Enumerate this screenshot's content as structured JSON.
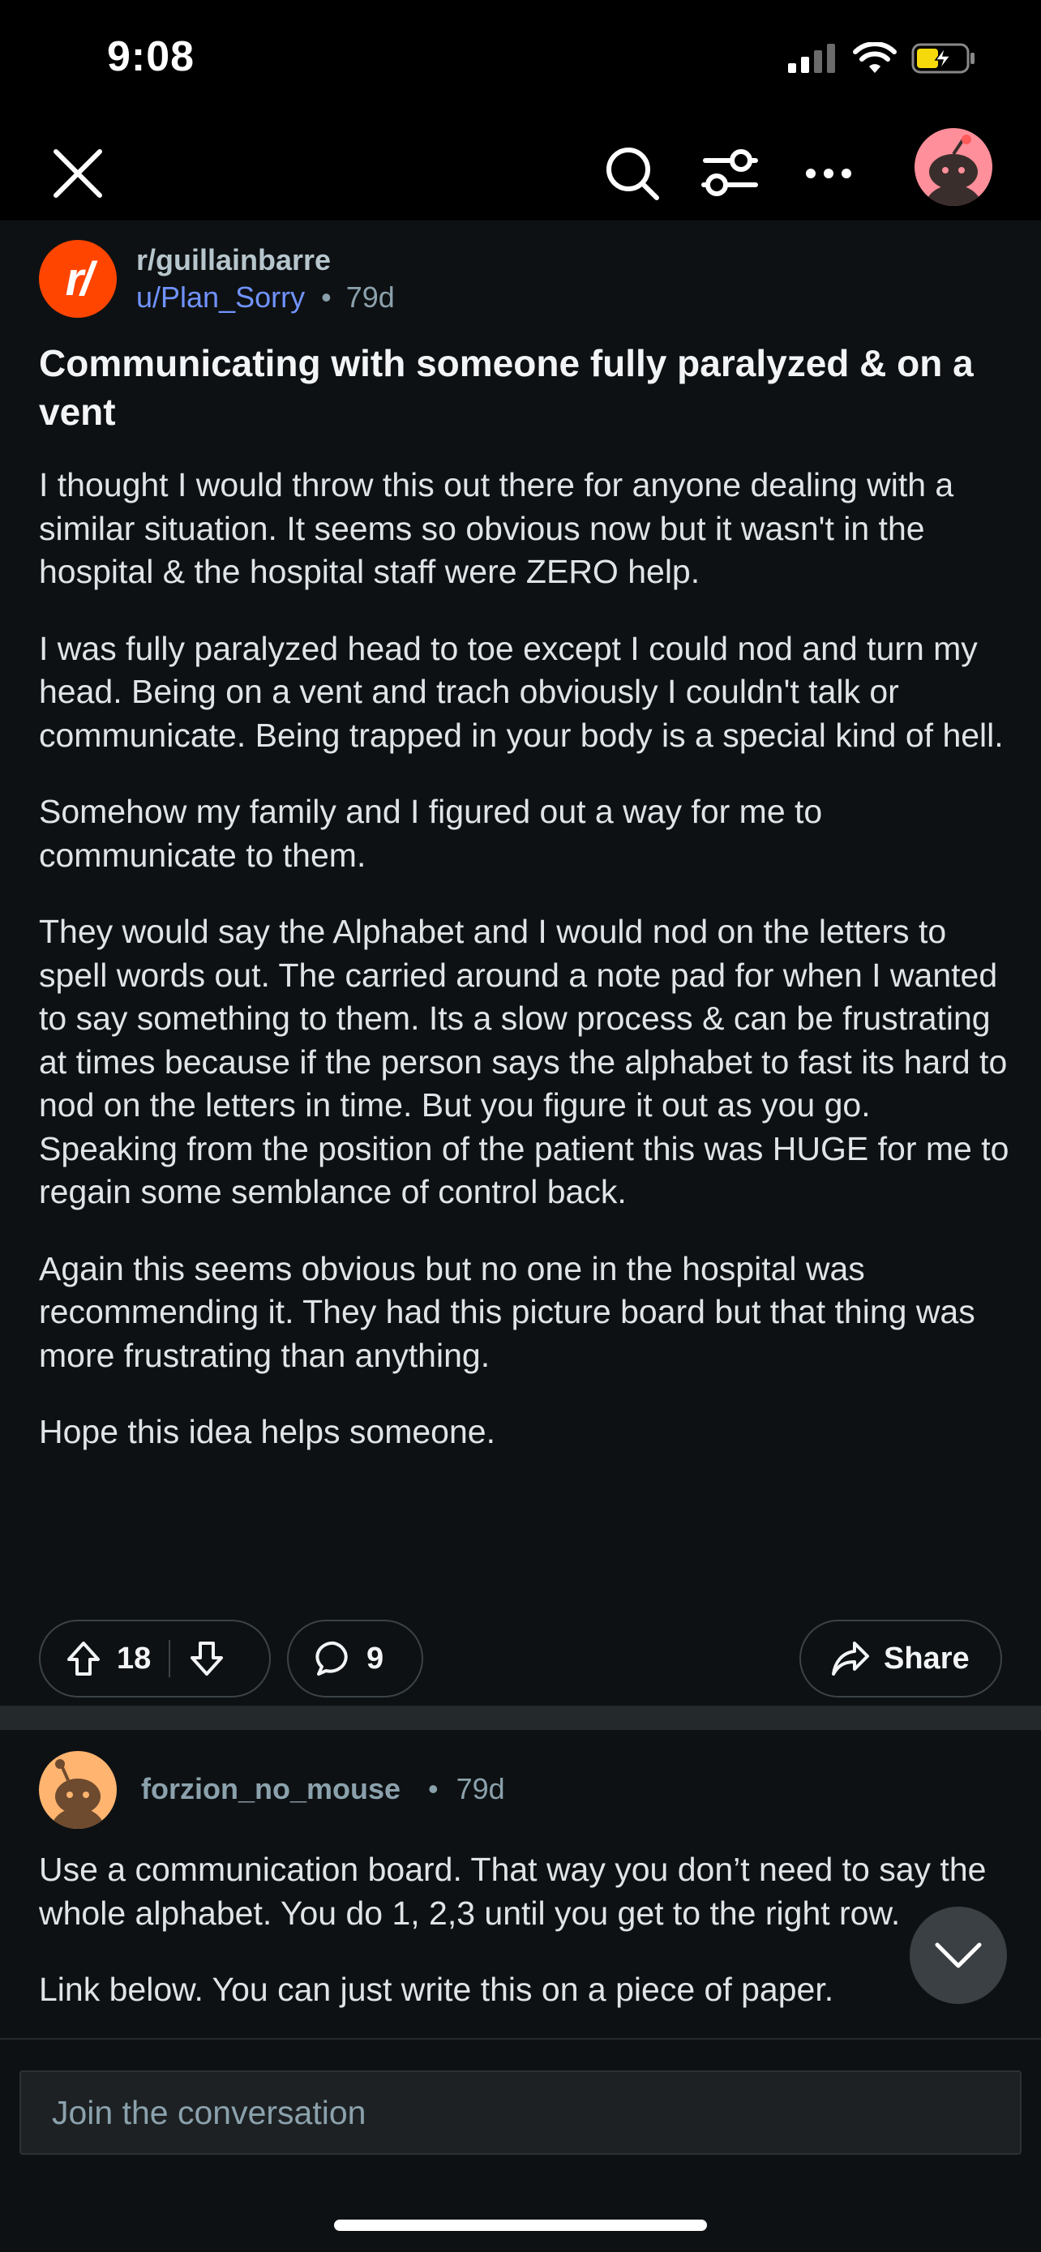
{
  "status": {
    "time": "9:08"
  },
  "nav": {
    "icons": [
      "close-icon",
      "search-icon",
      "filter-icon",
      "more-icon",
      "avatar"
    ]
  },
  "post": {
    "subreddit": "r/guillainbarre",
    "author": "u/Plan_Sorry",
    "separator": "•",
    "age": "79d",
    "title": "Communicating with someone fully paralyzed & on a vent",
    "paragraphs": [
      "I thought I would throw this out there for anyone dealing with a similar situation.  It seems so obvious now but it wasn't in the hospital & the hospital staff were ZERO help.",
      "I was fully paralyzed head to toe except I could nod and turn my head.  Being on a vent and trach obviously I couldn't talk or communicate.  Being trapped in your body is a special kind of hell.",
      "Somehow my family and I figured out a way for me to communicate to them.",
      "They would say the Alphabet and I would nod on the letters to spell words out.  The carried around a note pad for when I wanted to say something to them.  Its a slow process & can be frustrating at times because if the person says the alphabet to fast its hard to nod on the letters in time.  But you figure it out as you go.  Speaking from the position of the patient this was HUGE for me to regain some semblance of control back.",
      "Again this seems obvious but no one in the hospital was recommending it.  They had this picture board but that thing was more frustrating than anything.",
      "Hope this idea helps someone."
    ],
    "votes": "18",
    "comments": "9",
    "share_label": "Share"
  },
  "comment": {
    "author": "forzion_no_mouse",
    "separator": "•",
    "age": "79d",
    "paragraphs": [
      "Use a communication board. That way you don’t need to say the whole alphabet. You do 1, 2,3 until you get to the right row.",
      "Link below. You can just write this on a piece of paper."
    ]
  },
  "composer": {
    "placeholder": "Join the conversation"
  },
  "colors": {
    "brand": "#ff4500",
    "link": "#7193ff",
    "background": "#0e1113"
  }
}
